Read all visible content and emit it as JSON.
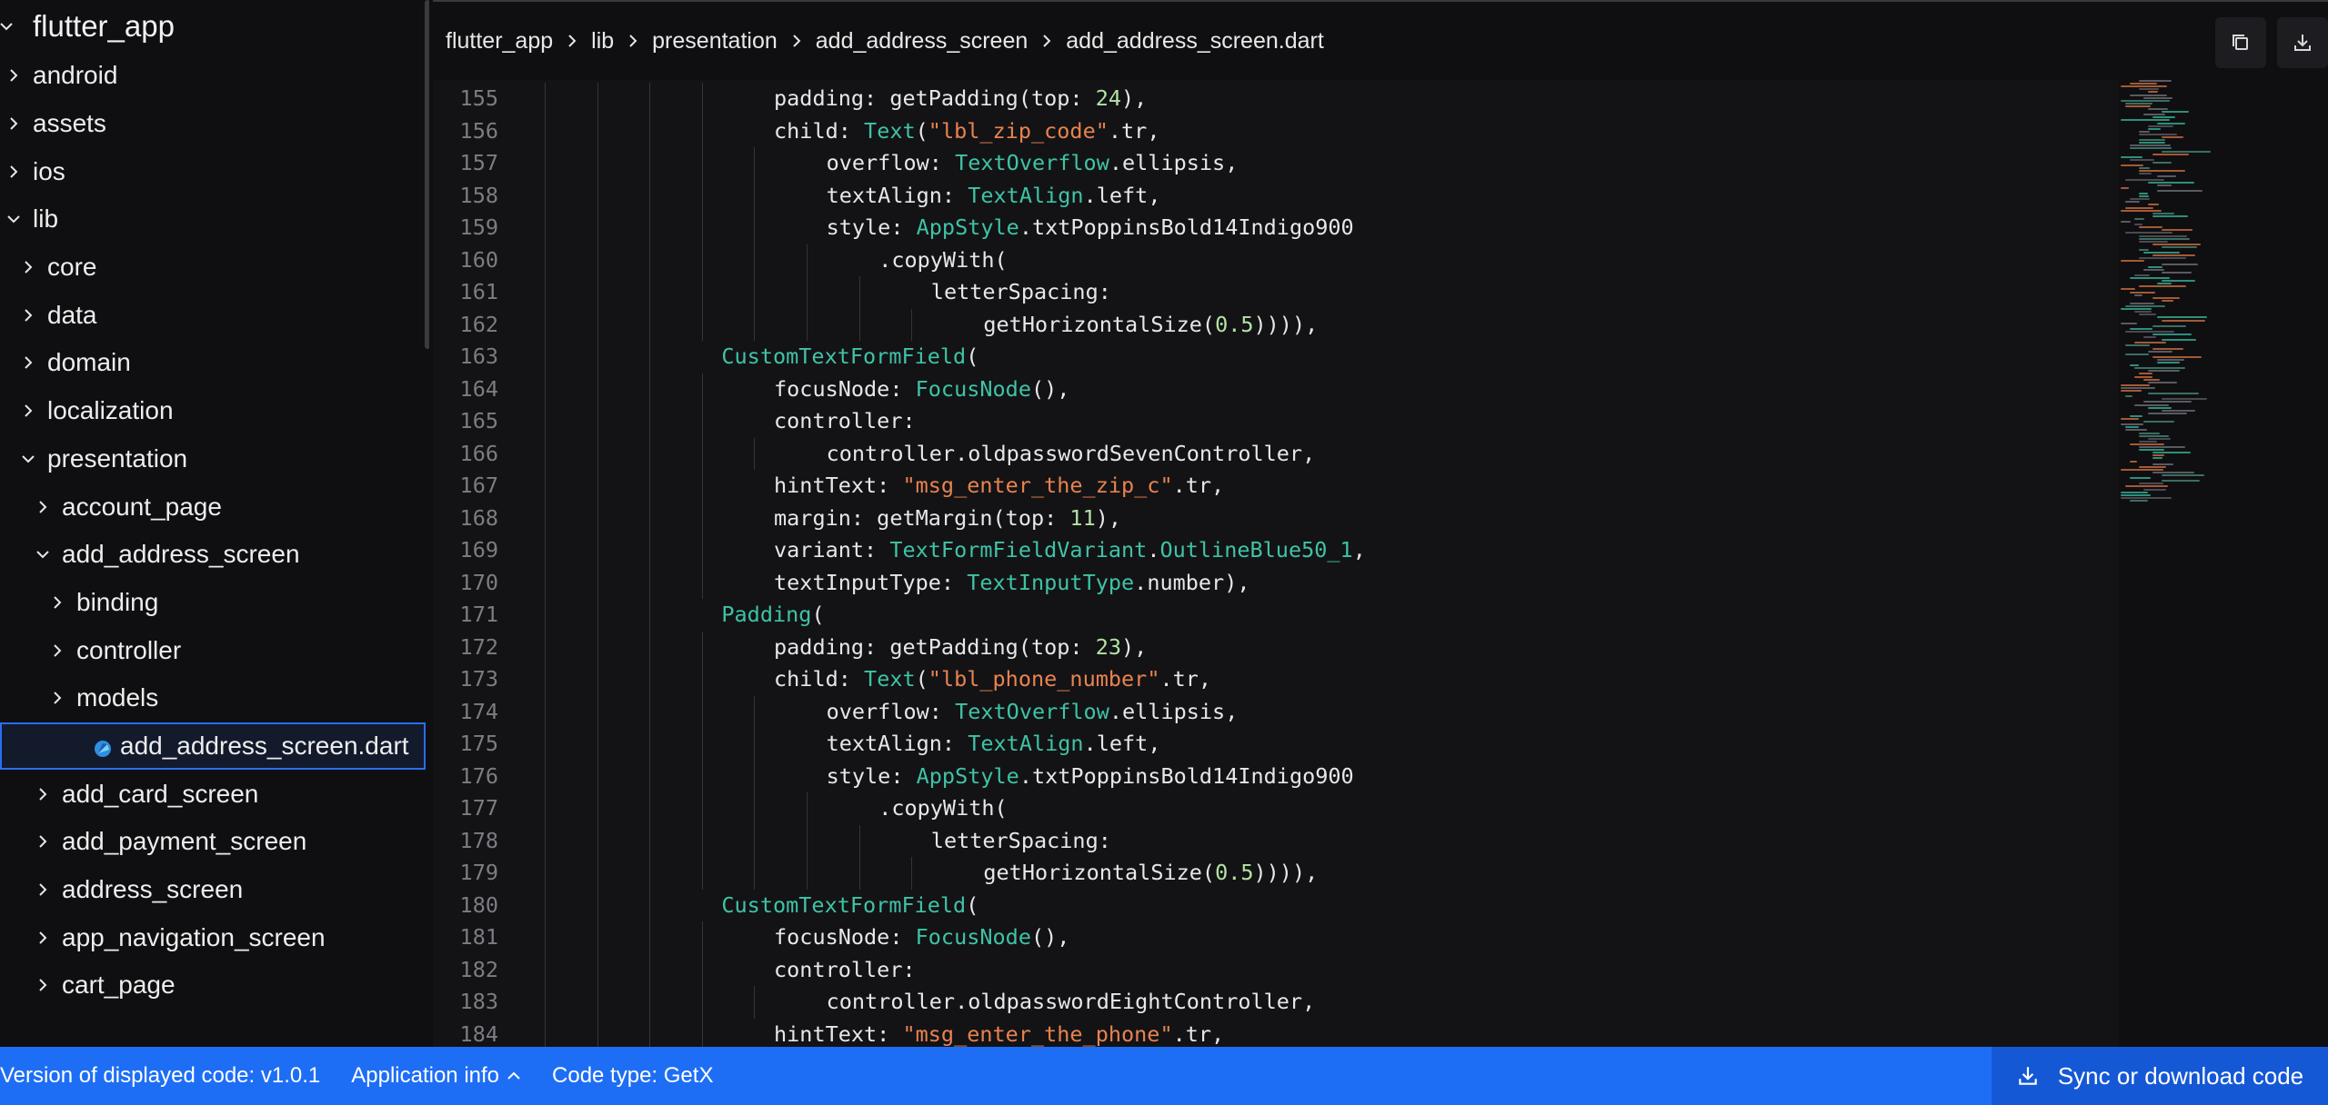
{
  "sidebar": {
    "root": "flutter_app",
    "items": [
      {
        "label": "android",
        "depth": 0,
        "expanded": false
      },
      {
        "label": "assets",
        "depth": 0,
        "expanded": false
      },
      {
        "label": "ios",
        "depth": 0,
        "expanded": false
      },
      {
        "label": "lib",
        "depth": 0,
        "expanded": true
      },
      {
        "label": "core",
        "depth": 1,
        "expanded": false
      },
      {
        "label": "data",
        "depth": 1,
        "expanded": false
      },
      {
        "label": "domain",
        "depth": 1,
        "expanded": false
      },
      {
        "label": "localization",
        "depth": 1,
        "expanded": false
      },
      {
        "label": "presentation",
        "depth": 1,
        "expanded": true
      },
      {
        "label": "account_page",
        "depth": 2,
        "expanded": false
      },
      {
        "label": "add_address_screen",
        "depth": 2,
        "expanded": true
      },
      {
        "label": "binding",
        "depth": 3,
        "expanded": false
      },
      {
        "label": "controller",
        "depth": 3,
        "expanded": false
      },
      {
        "label": "models",
        "depth": 3,
        "expanded": false
      },
      {
        "label": "add_address_screen.dart",
        "depth": 3,
        "file": true,
        "selected": true
      },
      {
        "label": "add_card_screen",
        "depth": 2,
        "expanded": false
      },
      {
        "label": "add_payment_screen",
        "depth": 2,
        "expanded": false
      },
      {
        "label": "address_screen",
        "depth": 2,
        "expanded": false
      },
      {
        "label": "app_navigation_screen",
        "depth": 2,
        "expanded": false
      },
      {
        "label": "cart_page",
        "depth": 2,
        "expanded": false
      }
    ]
  },
  "header": {
    "breadcrumb": [
      "flutter_app",
      "lib",
      "presentation",
      "add_address_screen",
      "add_address_screen.dart"
    ],
    "copy_icon": "copy-icon",
    "download_icon": "download-icon"
  },
  "editor": {
    "lines": [
      {
        "n": "155",
        "i": 4,
        "t": [
          [
            "padding: getPadding(top: ",
            ""
          ],
          [
            "24",
            "num"
          ],
          [
            "),",
            ""
          ]
        ]
      },
      {
        "n": "156",
        "i": 4,
        "t": [
          [
            "child: ",
            ""
          ],
          [
            "Text",
            "type"
          ],
          [
            "(",
            ""
          ],
          [
            "\"lbl_zip_code\"",
            "str"
          ],
          [
            ".tr,",
            ""
          ]
        ]
      },
      {
        "n": "157",
        "i": 5,
        "t": [
          [
            "overflow: ",
            ""
          ],
          [
            "TextOverflow",
            "type"
          ],
          [
            ".ellipsis,",
            ""
          ]
        ]
      },
      {
        "n": "158",
        "i": 5,
        "t": [
          [
            "textAlign: ",
            ""
          ],
          [
            "TextAlign",
            "type"
          ],
          [
            ".left,",
            ""
          ]
        ]
      },
      {
        "n": "159",
        "i": 5,
        "t": [
          [
            "style: ",
            ""
          ],
          [
            "AppStyle",
            "type"
          ],
          [
            ".txtPoppinsBold14Indigo900",
            ""
          ]
        ]
      },
      {
        "n": "160",
        "i": 6,
        "t": [
          [
            ".copyWith(",
            ""
          ]
        ]
      },
      {
        "n": "161",
        "i": 7,
        "t": [
          [
            "letterSpacing:",
            ""
          ]
        ]
      },
      {
        "n": "162",
        "i": 8,
        "t": [
          [
            "getHorizontalSize(",
            ""
          ],
          [
            "0.5",
            "num"
          ],
          [
            ")))),",
            ""
          ]
        ]
      },
      {
        "n": "163",
        "i": 3,
        "t": [
          [
            "CustomTextFormField",
            "type"
          ],
          [
            "(",
            ""
          ]
        ]
      },
      {
        "n": "164",
        "i": 4,
        "t": [
          [
            "focusNode: ",
            ""
          ],
          [
            "FocusNode",
            "type"
          ],
          [
            "(),",
            ""
          ]
        ]
      },
      {
        "n": "165",
        "i": 4,
        "t": [
          [
            "controller:",
            ""
          ]
        ]
      },
      {
        "n": "166",
        "i": 5,
        "t": [
          [
            "controller.oldpasswordSevenController,",
            ""
          ]
        ]
      },
      {
        "n": "167",
        "i": 4,
        "t": [
          [
            "hintText: ",
            ""
          ],
          [
            "\"msg_enter_the_zip_c\"",
            "str"
          ],
          [
            ".tr,",
            ""
          ]
        ]
      },
      {
        "n": "168",
        "i": 4,
        "t": [
          [
            "margin: getMargin(top: ",
            ""
          ],
          [
            "11",
            "num"
          ],
          [
            "),",
            ""
          ]
        ]
      },
      {
        "n": "169",
        "i": 4,
        "t": [
          [
            "variant: ",
            ""
          ],
          [
            "TextFormFieldVariant",
            "type"
          ],
          [
            ".",
            ""
          ],
          [
            "OutlineBlue50_1",
            "type"
          ],
          [
            ",",
            ""
          ]
        ]
      },
      {
        "n": "170",
        "i": 4,
        "t": [
          [
            "textInputType: ",
            ""
          ],
          [
            "TextInputType",
            "type"
          ],
          [
            ".number),",
            ""
          ]
        ]
      },
      {
        "n": "171",
        "i": 3,
        "t": [
          [
            "Padding",
            "type"
          ],
          [
            "(",
            ""
          ]
        ]
      },
      {
        "n": "172",
        "i": 4,
        "t": [
          [
            "padding: getPadding(top: ",
            ""
          ],
          [
            "23",
            "num"
          ],
          [
            "),",
            ""
          ]
        ]
      },
      {
        "n": "173",
        "i": 4,
        "t": [
          [
            "child: ",
            ""
          ],
          [
            "Text",
            "type"
          ],
          [
            "(",
            ""
          ],
          [
            "\"lbl_phone_number\"",
            "str"
          ],
          [
            ".tr,",
            ""
          ]
        ]
      },
      {
        "n": "174",
        "i": 5,
        "t": [
          [
            "overflow: ",
            ""
          ],
          [
            "TextOverflow",
            "type"
          ],
          [
            ".ellipsis,",
            ""
          ]
        ]
      },
      {
        "n": "175",
        "i": 5,
        "t": [
          [
            "textAlign: ",
            ""
          ],
          [
            "TextAlign",
            "type"
          ],
          [
            ".left,",
            ""
          ]
        ]
      },
      {
        "n": "176",
        "i": 5,
        "t": [
          [
            "style: ",
            ""
          ],
          [
            "AppStyle",
            "type"
          ],
          [
            ".txtPoppinsBold14Indigo900",
            ""
          ]
        ]
      },
      {
        "n": "177",
        "i": 6,
        "t": [
          [
            ".copyWith(",
            ""
          ]
        ]
      },
      {
        "n": "178",
        "i": 7,
        "t": [
          [
            "letterSpacing:",
            ""
          ]
        ]
      },
      {
        "n": "179",
        "i": 8,
        "t": [
          [
            "getHorizontalSize(",
            ""
          ],
          [
            "0.5",
            "num"
          ],
          [
            ")))),",
            ""
          ]
        ]
      },
      {
        "n": "180",
        "i": 3,
        "t": [
          [
            "CustomTextFormField",
            "type"
          ],
          [
            "(",
            ""
          ]
        ]
      },
      {
        "n": "181",
        "i": 4,
        "t": [
          [
            "focusNode: ",
            ""
          ],
          [
            "FocusNode",
            "type"
          ],
          [
            "(),",
            ""
          ]
        ]
      },
      {
        "n": "182",
        "i": 4,
        "t": [
          [
            "controller:",
            ""
          ]
        ]
      },
      {
        "n": "183",
        "i": 5,
        "t": [
          [
            "controller.oldpasswordEightController,",
            ""
          ]
        ]
      },
      {
        "n": "184",
        "i": 4,
        "t": [
          [
            "hintText: ",
            ""
          ],
          [
            "\"msg_enter_the_phone\"",
            "str"
          ],
          [
            ".tr,",
            ""
          ]
        ]
      }
    ]
  },
  "footer": {
    "version": "Version of displayed code: v1.0.1",
    "app_info": "Application info",
    "code_type": "Code type: GetX",
    "sync_button": "Sync or download code"
  },
  "colors": {
    "accent": "#1e6ef5",
    "type": "#3fc3a6",
    "string": "#e8834e",
    "number": "#b3e3a4"
  }
}
